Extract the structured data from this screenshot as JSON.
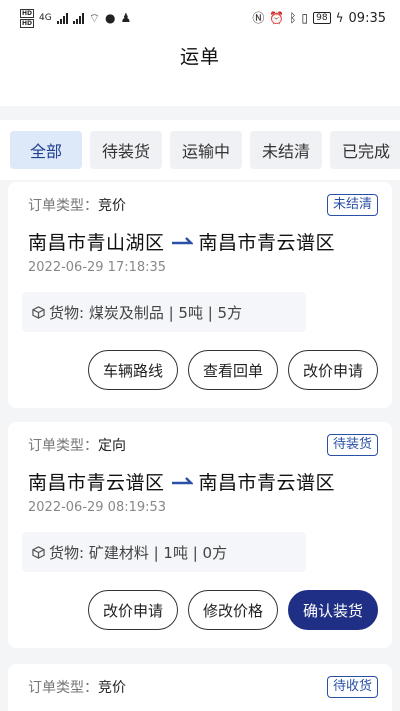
{
  "statusbar": {
    "hd1": "HD",
    "hd2": "HD",
    "net": "4G",
    "battery": "98",
    "time": "09:35"
  },
  "header": {
    "title": "运单"
  },
  "tabs": [
    {
      "label": "全部",
      "active": true
    },
    {
      "label": "待装货",
      "active": false
    },
    {
      "label": "运输中",
      "active": false
    },
    {
      "label": "未结清",
      "active": false
    },
    {
      "label": "已完成",
      "active": false
    }
  ],
  "orders": [
    {
      "type_label": "订单类型：",
      "type_value": "竞价",
      "status": "未结清",
      "from": "南昌市青山湖区",
      "to": "南昌市青云谱区",
      "date": "2022-06-29 17:18:35",
      "goods": "货物: 煤炭及制品 | 5吨 | 5方",
      "actions": [
        "车辆路线",
        "查看回单",
        "改价申请"
      ]
    },
    {
      "type_label": "订单类型：",
      "type_value": "定向",
      "status": "待装货",
      "from": "南昌市青云谱区",
      "to": "南昌市青云谱区",
      "date": "2022-06-29 08:19:53",
      "goods": "货物: 矿建材料 | 1吨 | 0方",
      "actions": [
        "改价申请",
        "修改价格",
        "确认装货"
      ]
    },
    {
      "type_label": "订单类型：",
      "type_value": "竞价",
      "status": "待收货"
    }
  ],
  "colors": {
    "accent": "#1f2f86",
    "tab_active_bg": "#dde8f8",
    "status_border": "#2a51a5"
  }
}
